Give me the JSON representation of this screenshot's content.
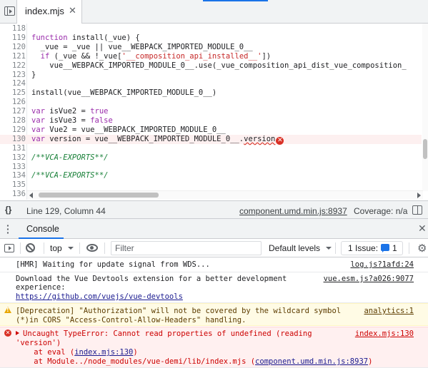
{
  "tab_bar": {
    "file_tab": "index.mjs",
    "close_glyph": "✕"
  },
  "editor": {
    "lines": [
      {
        "n": "118",
        "code": ""
      },
      {
        "n": "119",
        "code": "function install(_vue) {"
      },
      {
        "n": "120",
        "code": "  _vue = _vue || vue__WEBPACK_IMPORTED_MODULE_0__"
      },
      {
        "n": "121",
        "code": "  if (_vue && !_vue['__composition_api_installed__'])"
      },
      {
        "n": "122",
        "code": "    vue__WEBPACK_IMPORTED_MODULE_0__.use(_vue_composition_api_dist_vue_composition_"
      },
      {
        "n": "123",
        "code": "}"
      },
      {
        "n": "124",
        "code": ""
      },
      {
        "n": "125",
        "code": "install(vue__WEBPACK_IMPORTED_MODULE_0__)"
      },
      {
        "n": "126",
        "code": ""
      },
      {
        "n": "127",
        "code": "var isVue2 = true"
      },
      {
        "n": "128",
        "code": "var isVue3 = false"
      },
      {
        "n": "129",
        "code": "var Vue2 = vue__WEBPACK_IMPORTED_MODULE_0__"
      },
      {
        "n": "130",
        "code": "var version = vue__WEBPACK_IMPORTED_MODULE_0__.version"
      },
      {
        "n": "131",
        "code": ""
      },
      {
        "n": "132",
        "code": "/**VCA-EXPORTS**/"
      },
      {
        "n": "133",
        "code": ""
      },
      {
        "n": "134",
        "code": "/**VCA-EXPORTS**/"
      },
      {
        "n": "135",
        "code": ""
      },
      {
        "n": "136",
        "code": ""
      }
    ],
    "error_line": "130"
  },
  "status_bar": {
    "braces": "{}",
    "position": "Line 129, Column 44",
    "source_link": "component.umd.min.js:8937",
    "coverage": "Coverage: n/a"
  },
  "drawer": {
    "tab": "Console",
    "close_glyph": "✕"
  },
  "console_toolbar": {
    "context": "top",
    "filter_placeholder": "Filter",
    "levels": "Default levels",
    "issues_label": "1 Issue:",
    "issues_count": "1"
  },
  "messages": [
    {
      "type": "log",
      "text": "[HMR] Waiting for update signal from WDS...",
      "source": "log.js?1afd:24"
    },
    {
      "type": "log",
      "line1": "Download the Vue Devtools extension for a better development",
      "line2": "experience:",
      "link": "https://github.com/vuejs/vue-devtools",
      "source": "vue.esm.js?a026:9077"
    },
    {
      "type": "warning",
      "line1": "[Deprecation] \"Authorization\" will not be covered by the wildcard symbol",
      "line2": "(*)in CORS \"Access-Control-Allow-Headers\" handling.",
      "source": "analytics:1"
    },
    {
      "type": "error",
      "line1": "Uncaught TypeError: Cannot read properties of undefined (reading",
      "line2": "'version')",
      "line3_prefix": "    at eval (",
      "line3_link": "index.mjs:130",
      "line3_suffix": ")",
      "line4_prefix": "    at Module../node_modules/vue-demi/lib/index.mjs (",
      "line4_link": "component.umd.min.js:8937",
      "line4_suffix": ")",
      "source": "index.mjs:130"
    }
  ],
  "colors": {
    "accent": "#1a73e8",
    "error": "#d93025",
    "warning_bg": "#fffbe5",
    "error_bg": "#fff0f0"
  }
}
